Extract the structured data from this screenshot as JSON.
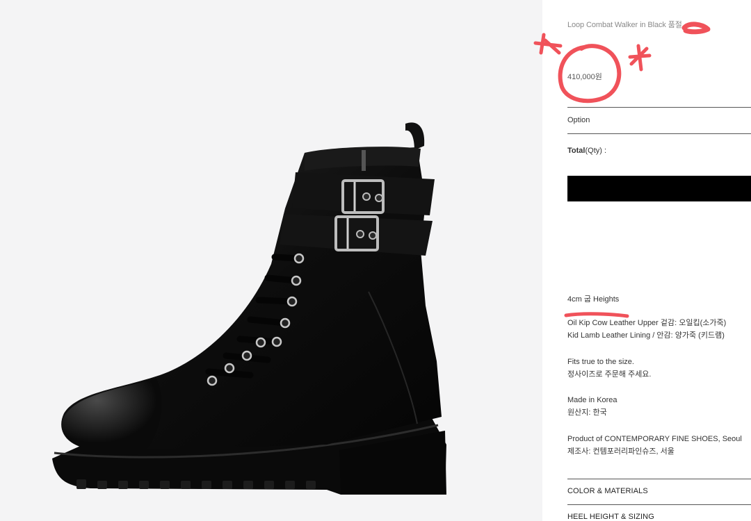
{
  "product": {
    "name": "Loop Combat Walker in Black 품절",
    "price": "410,000원",
    "image_icon": "black-combat-boot-photo"
  },
  "order": {
    "option_label": "Option",
    "total_label": "Total",
    "total_suffix": "(Qty) :"
  },
  "details": {
    "heights": "4cm 굽 Heights",
    "materials": [
      "Oil Kip Cow Leather Upper 겉감: 오일킵(소가죽)",
      "Kid Lamb Leather Lining / 안감: 양가죽 (키드램)"
    ],
    "fit": [
      "Fits true to the size.",
      "정사이즈로 주문해 주세요."
    ],
    "origin": [
      "Made in Korea",
      "원산지: 한국"
    ],
    "maker": [
      "Product of CONTEMPORARY FINE SHOES, Seoul",
      "제조사: 컨템포러리파인슈즈, 서울"
    ]
  },
  "accordion": {
    "color_materials": "COLOR & MATERIALS",
    "heel_sizing": "HEEL HEIGHT & SIZING"
  },
  "colors": {
    "annotation": "#f0525a",
    "buy_bar": "#000000"
  }
}
